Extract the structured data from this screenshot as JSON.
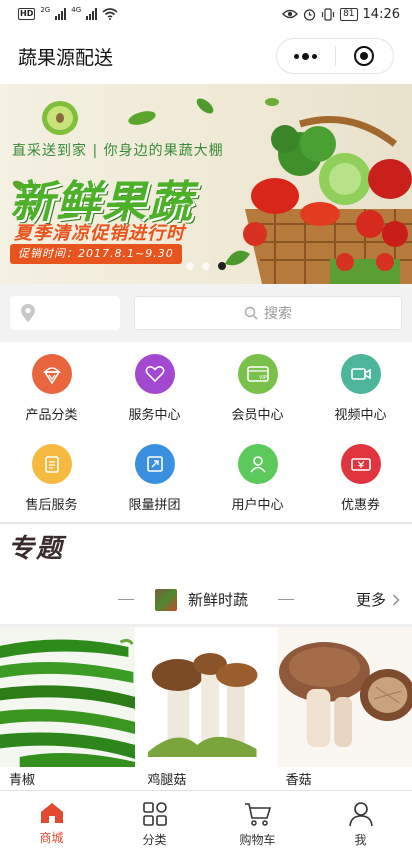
{
  "status_bar": {
    "time": "14:26",
    "battery": "81",
    "network_a": "2G",
    "network_b": "4G",
    "hd": "HD"
  },
  "header": {
    "title": "蔬果源配送"
  },
  "banner": {
    "subtitle": "直采送到家 | 你身边的果蔬大棚",
    "title": "新鲜果蔬",
    "promo": "夏季清凉促销进行时",
    "date": "促销时间：2017.8.1~9.30",
    "slide_count": 3,
    "active_slide": 3
  },
  "search": {
    "placeholder": "搜索"
  },
  "menu": [
    {
      "label": "产品分类",
      "icon": "ice-cream-icon",
      "color": "#e8653d"
    },
    {
      "label": "服务中心",
      "icon": "heart-icon",
      "color": "#a348d1"
    },
    {
      "label": "会员中心",
      "icon": "vip-card-icon",
      "color": "#79c14a"
    },
    {
      "label": "视频中心",
      "icon": "video-camera-icon",
      "color": "#4db599"
    },
    {
      "label": "售后服务",
      "icon": "clipboard-icon",
      "color": "#f6b93f"
    },
    {
      "label": "限量拼团",
      "icon": "share-box-icon",
      "color": "#3a8fe0"
    },
    {
      "label": "用户中心",
      "icon": "user-icon",
      "color": "#5cc95c"
    },
    {
      "label": "优惠券",
      "icon": "coupon-icon",
      "color": "#e0353f"
    }
  ],
  "topic": {
    "title": "专题",
    "category": "新鲜时蔬",
    "more": "更多"
  },
  "products": [
    {
      "name": "青椒"
    },
    {
      "name": "鸡腿菇"
    },
    {
      "name": "香菇"
    }
  ],
  "tabs": [
    {
      "label": "商城",
      "icon": "home-icon",
      "active": true
    },
    {
      "label": "分类",
      "icon": "grid-icon",
      "active": false
    },
    {
      "label": "购物车",
      "icon": "cart-icon",
      "active": false
    },
    {
      "label": "我",
      "icon": "profile-icon",
      "active": false
    }
  ],
  "colors": {
    "accent": "#e2492e",
    "banner_green": "#4cb128",
    "promo_orange": "#e8541e"
  }
}
